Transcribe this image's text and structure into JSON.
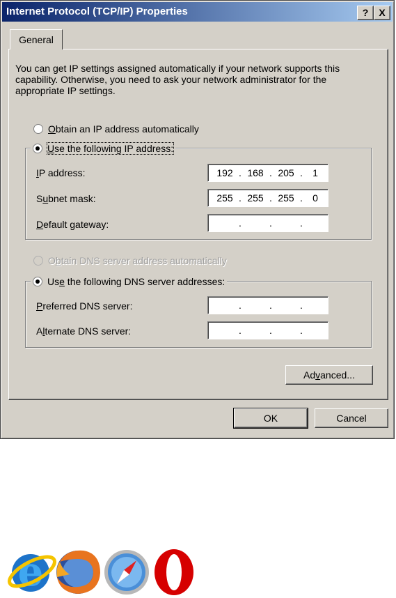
{
  "window": {
    "title": "Internet Protocol (TCP/IP) Properties",
    "help_glyph": "?",
    "close_glyph": "X"
  },
  "tabs": [
    {
      "label": "General"
    }
  ],
  "intro": "You can get IP settings assigned automatically if your network supports this capability. Otherwise, you need to ask your network administrator for the appropriate IP settings.",
  "ip_mode": {
    "auto": {
      "label_key": "O",
      "label_rest": "btain an IP address automatically",
      "selected": false
    },
    "manual": {
      "label_key": "U",
      "label_rest": "se the following IP address:",
      "selected": true
    }
  },
  "ip_fields": {
    "ip_address": {
      "label_key": "I",
      "label_rest": "P address:",
      "octets": [
        "192",
        "168",
        "205",
        "1"
      ]
    },
    "subnet_mask": {
      "label_pre": "S",
      "label_key": "u",
      "label_rest": "bnet mask:",
      "octets": [
        "255",
        "255",
        "255",
        "0"
      ]
    },
    "default_gateway": {
      "label_key": "D",
      "label_rest": "efault gateway:",
      "octets": [
        "",
        "",
        "",
        ""
      ]
    }
  },
  "dns_mode": {
    "auto": {
      "label_pre": "O",
      "label_key": "b",
      "label_rest": "tain DNS server address automatically",
      "disabled": true,
      "selected": false
    },
    "manual": {
      "label_pre": "Us",
      "label_key": "e",
      "label_rest": " the following DNS server addresses:",
      "selected": true
    }
  },
  "dns_fields": {
    "preferred": {
      "label_key": "P",
      "label_rest": "referred DNS server:",
      "octets": [
        "",
        "",
        "",
        ""
      ]
    },
    "alternate": {
      "label_pre": "A",
      "label_key": "l",
      "label_rest": "ternate DNS server:",
      "octets": [
        "",
        "",
        "",
        ""
      ]
    }
  },
  "buttons": {
    "advanced": {
      "pre": "Ad",
      "key": "v",
      "rest": "anced..."
    },
    "ok": "OK",
    "cancel": "Cancel"
  },
  "dot": ".",
  "logos": [
    "internet-explorer",
    "firefox",
    "safari",
    "opera"
  ],
  "colors": {
    "titlebar_start": "#0a246a",
    "titlebar_end": "#a6caf0",
    "face": "#d4d0c8"
  }
}
